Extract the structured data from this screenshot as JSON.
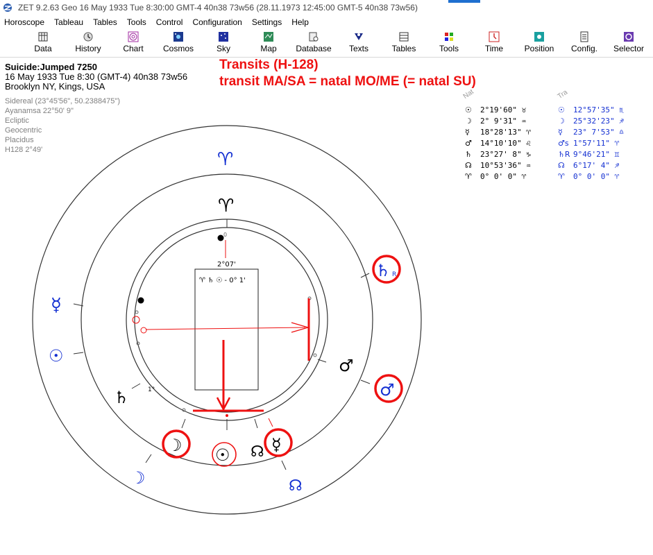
{
  "window": {
    "title": "ZET 9.2.63 Geo   16 May 1933  Tue   8:30:00 GMT-4 40n38  73w56  (28.11.1973  12:45:00 GMT-5 40n38 73w56)"
  },
  "menu": [
    "Horoscope",
    "Tableau",
    "Tables",
    "Tools",
    "Control",
    "Configuration",
    "Settings",
    "Help"
  ],
  "toolbar": [
    {
      "label": "Data",
      "icon": "data-icon"
    },
    {
      "label": "History",
      "icon": "history-icon"
    },
    {
      "label": "Chart",
      "icon": "chart-icon"
    },
    {
      "label": "Cosmos",
      "icon": "cosmos-icon"
    },
    {
      "label": "Sky",
      "icon": "sky-icon"
    },
    {
      "label": "Map",
      "icon": "map-icon"
    },
    {
      "label": "Database",
      "icon": "database-icon"
    },
    {
      "label": "Texts",
      "icon": "texts-icon"
    },
    {
      "label": "Tables",
      "icon": "tables-icon"
    },
    {
      "label": "Tools",
      "icon": "tools-icon"
    },
    {
      "label": "Time",
      "icon": "time-icon"
    },
    {
      "label": "Position",
      "icon": "position-icon"
    },
    {
      "label": "Config.",
      "icon": "config-icon"
    },
    {
      "label": "Selector",
      "icon": "selector-icon"
    }
  ],
  "info": {
    "subject": "Suicide:Jumped 7250",
    "date_line": "16 May 1933  Tue   8:30 (GMT-4) 40n38  73w56",
    "place": "Brooklyn NY, Kings, USA"
  },
  "settings": {
    "zodiac": "Sidereal (23°45'56\", 50.2388475\")",
    "ayanamsa": "Ayanamsa 22°50' 9\"",
    "coordinates": "Ecliptic",
    "center": "Geocentric",
    "houses": "Placidus",
    "harmonic": "H128   2°49'"
  },
  "annotation": {
    "line1": "Transits (H-128)",
    "line2": "transit MA/SA = natal MO/ME (= natal SU)"
  },
  "tables": {
    "natal_header": "Nat",
    "transit_header": "Tra",
    "natal_rows": [
      {
        "glyph": "☉",
        "pos": "2°19'60\" ♉"
      },
      {
        "glyph": "☽",
        "pos": "2° 9'31\" ♒"
      },
      {
        "glyph": "☿",
        "pos": "18°28'13\" ♈"
      },
      {
        "glyph": "♂",
        "pos": "14°10'10\" ♌"
      },
      {
        "glyph": "♄",
        "pos": "23°27' 8\" ♑"
      },
      {
        "glyph": "☊",
        "pos": "10°53'36\" ♒"
      },
      {
        "glyph": "♈",
        "pos": "0° 0' 0\" ♈"
      }
    ],
    "transit_rows": [
      {
        "glyph": "☉",
        "pos": "12°57'35\" ♏"
      },
      {
        "glyph": "☽",
        "pos": "25°32'23\" ♐"
      },
      {
        "glyph": "☿",
        "pos": "23° 7'53\" ♎"
      },
      {
        "glyph": "♂s",
        "pos": "1°57'11\" ♈"
      },
      {
        "glyph": "♄R",
        "pos": "9°46'21\" ♊"
      },
      {
        "glyph": "☊",
        "pos": "6°17' 4\" ♐"
      },
      {
        "glyph": "♈",
        "pos": "0° 0' 0\" ♈"
      }
    ]
  },
  "chart": {
    "inner_label": "2°07'",
    "aspect_text": "♈ ♄ ☉ - 0° 1'",
    "cusp_label": "1°",
    "zero_label": "0",
    "retro_label": "R",
    "natal_glyphs": {
      "aries": "♈",
      "mercury": "☿",
      "mars": "♂",
      "saturn": "♄",
      "moon": "☽",
      "sun": "☉",
      "node": "☊"
    },
    "transit_glyphs": {
      "aries": "♈",
      "saturn": "♄",
      "mercury": "☿",
      "sun": "☉",
      "mars": "♂",
      "moon": "☽",
      "node": "☊"
    },
    "colors": {
      "natal": "#000000",
      "transit": "#1430d2",
      "highlight": "#ee1111",
      "ring": "#444444"
    }
  }
}
